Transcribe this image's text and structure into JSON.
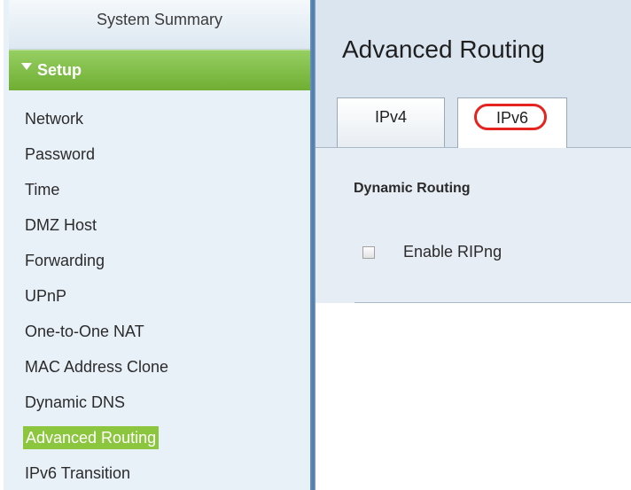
{
  "sidebar": {
    "system_summary": "System Summary",
    "section": "Setup",
    "items": [
      {
        "label": "Network"
      },
      {
        "label": "Password"
      },
      {
        "label": "Time"
      },
      {
        "label": "DMZ Host"
      },
      {
        "label": "Forwarding"
      },
      {
        "label": "UPnP"
      },
      {
        "label": "One-to-One NAT"
      },
      {
        "label": "MAC Address Clone"
      },
      {
        "label": "Dynamic DNS"
      },
      {
        "label": "Advanced Routing",
        "active": true
      },
      {
        "label": "IPv6 Transition"
      }
    ]
  },
  "main": {
    "title": "Advanced Routing",
    "tabs": [
      {
        "label": "IPv4",
        "selected": false
      },
      {
        "label": "IPv6",
        "selected": true,
        "highlighted": true
      }
    ],
    "section_title": "Dynamic Routing",
    "enable_ripng": {
      "label": "Enable RIPng",
      "checked": false
    }
  },
  "colors": {
    "setup_green": "#7cbb3f",
    "active_item": "#8cc63f",
    "highlight_circle": "#e5231f",
    "sidebar_bg": "#e9f1f8",
    "panel_bg": "#e6edf4"
  }
}
